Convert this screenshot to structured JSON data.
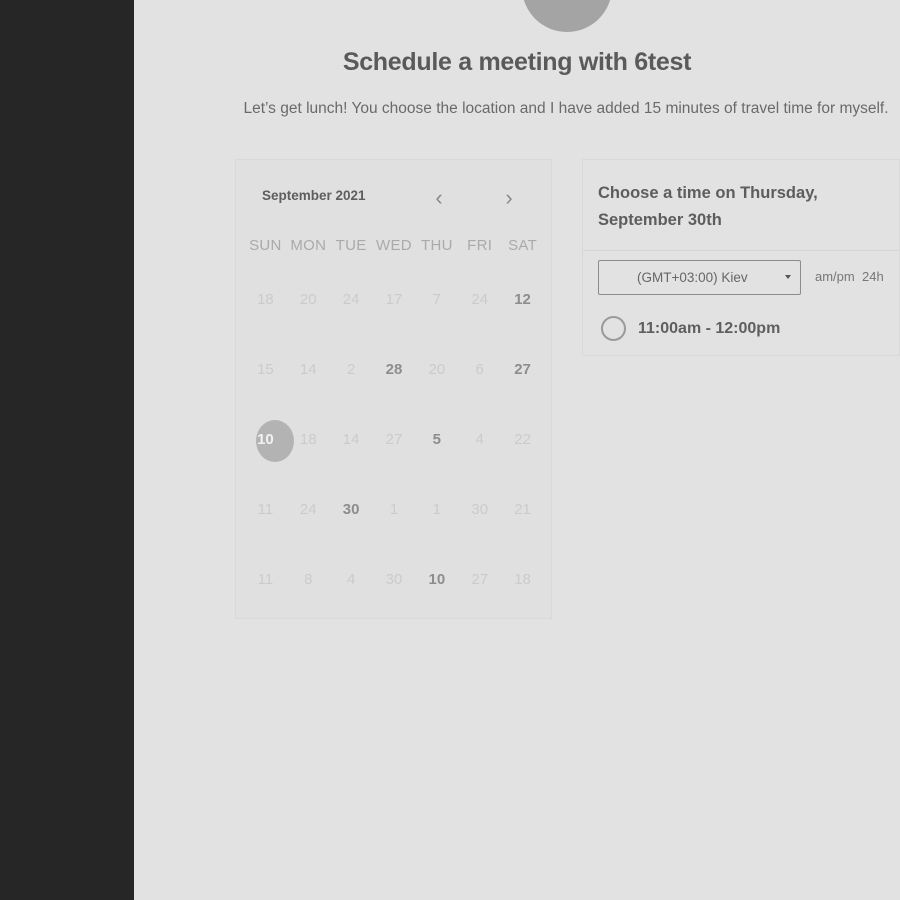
{
  "page": {
    "title": "Schedule a meeting with 6test",
    "subtitle": "Let’s get lunch! You choose the location and I have added 15 minutes of travel time for myself."
  },
  "calendar": {
    "month_label": "September 2021",
    "prev_icon": "chevron-left-icon",
    "next_icon": "chevron-right-icon",
    "weekdays": [
      "SUN",
      "MON",
      "TUE",
      "WED",
      "THU",
      "FRI",
      "SAT"
    ],
    "weeks": [
      [
        "18",
        "20",
        "24",
        "17",
        "7",
        "24",
        "12"
      ],
      [
        "15",
        "14",
        "2",
        "28",
        "20",
        "6",
        "27"
      ],
      [
        "10",
        "18",
        "14",
        "27",
        "5",
        "4",
        "22"
      ],
      [
        "11",
        "24",
        "30",
        "1",
        "1",
        "30",
        "21"
      ],
      [
        "11",
        "8",
        "4",
        "30",
        "10",
        "27",
        "18"
      ]
    ],
    "available_days": [
      "12",
      "28",
      "27",
      "5",
      "30",
      "10"
    ],
    "selected_day": "10"
  },
  "time_panel": {
    "heading_line1": "Choose a time on Thursday,",
    "heading_line2": "September 30th",
    "timezone": "(GMT+03:00) Kiev",
    "format_ampm": "am/pm",
    "format_24h": "24h",
    "slots": [
      "11:00am - 12:00pm"
    ]
  },
  "colors": {
    "sidebar": "#262626",
    "background": "#e2e2e2",
    "avatar": "#a4a4a4"
  }
}
